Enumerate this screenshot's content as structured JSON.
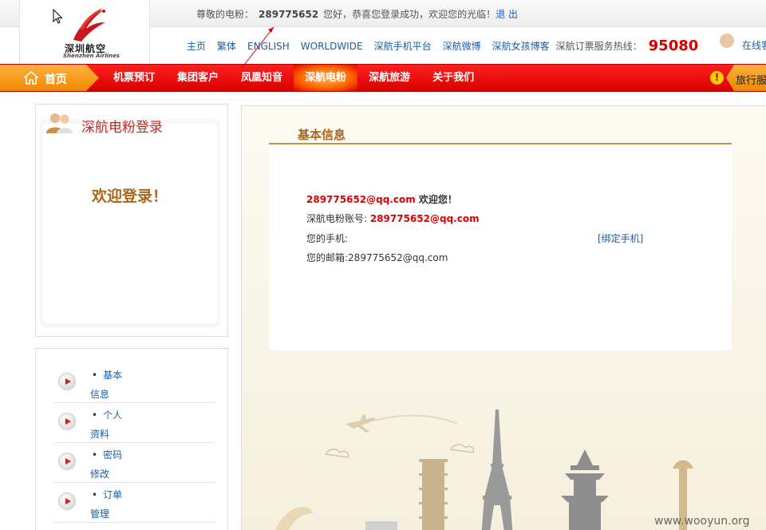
{
  "topbar": {
    "greeting_prefix": "尊敬的电粉：",
    "user_id": "289775652",
    "greeting_suffix": "您好，恭喜您登录成功，欢迎您的光临！",
    "logout": "退 出"
  },
  "logo": {
    "cn": "深圳航空",
    "en": "Shenzhen Airlines"
  },
  "top_links": {
    "items": [
      "主页",
      "繁体",
      "ENGLISH",
      "WORLDWIDE",
      "深航手机平台",
      "深航微博",
      "深航女孩博客"
    ],
    "hotline_label": "深航订票服务热线：",
    "hotline_number": "95080",
    "online_service": "在线客"
  },
  "nav": {
    "home": "首页",
    "items": [
      "机票预订",
      "集团客户",
      "凤凰知音",
      "深航电粉",
      "深航旅游",
      "关于我们"
    ],
    "active_index": 3,
    "travel": "旅行服务",
    "alert_glyph": "!"
  },
  "sidebar": {
    "login_title": "深航电粉登录",
    "welcome": "欢迎登录！",
    "menu": [
      {
        "line1": "基本",
        "line2": "信息"
      },
      {
        "line1": "个人",
        "line2": "资料"
      },
      {
        "line1": "密码",
        "line2": "修改"
      },
      {
        "line1": "订单",
        "line2": "管理"
      }
    ]
  },
  "main": {
    "section_title": "基本信息",
    "email_display": "289775652@qq.com",
    "welcome_suffix": " 欢迎您！",
    "account_label": "深航电粉账号: ",
    "account_value": "289775652@qq.com",
    "phone_label": "您的手机:",
    "bind_phone": "[绑定手机]",
    "email_label": "您的邮箱:",
    "email_value": "289775652@qq.com"
  },
  "watermark": "www.wooyun.org",
  "colors": {
    "brand_red": "#e00000",
    "nav_orange": "#f08a00",
    "title_brown": "#a8661a",
    "link_blue": "#1c5da8"
  }
}
